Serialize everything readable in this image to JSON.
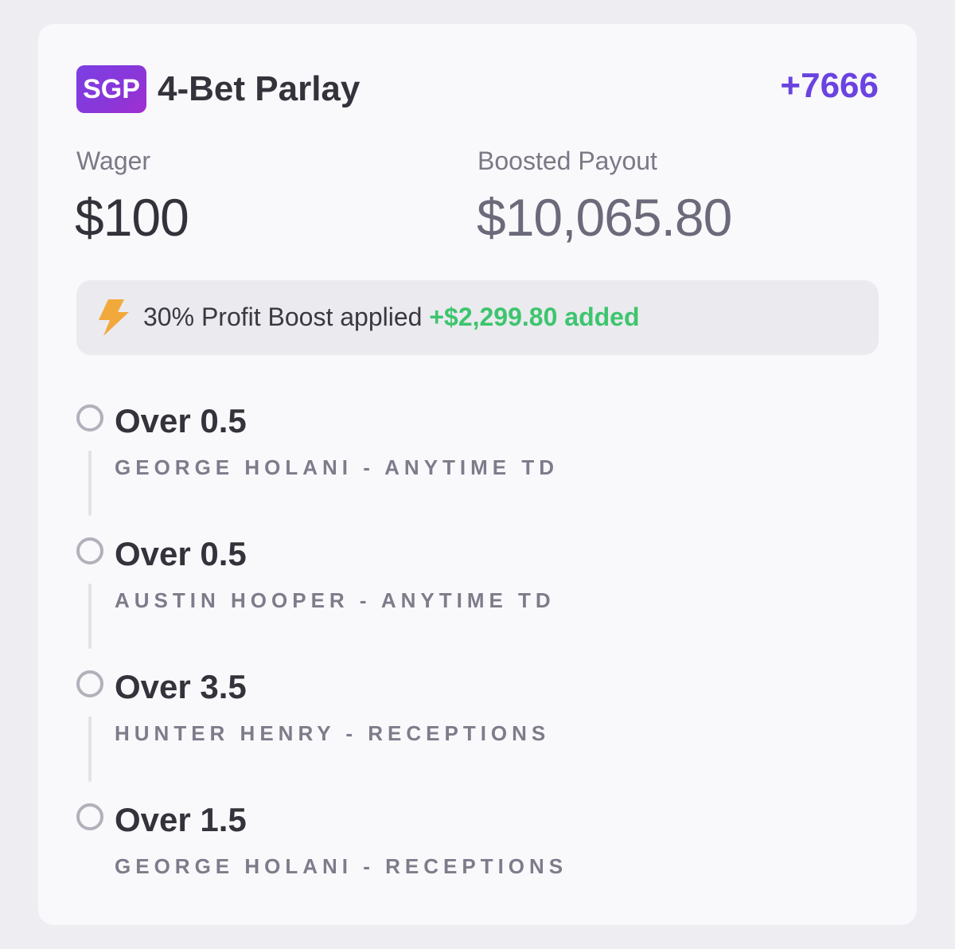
{
  "header": {
    "badge": "SGP",
    "title": "4-Bet Parlay",
    "odds": "+7666"
  },
  "wager": {
    "label": "Wager",
    "value": "$100"
  },
  "payout": {
    "label": "Boosted Payout",
    "value": "$10,065.80"
  },
  "boost": {
    "icon": "lightning-bolt-icon",
    "text": "30% Profit Boost applied",
    "added": "+$2,299.80 added"
  },
  "legs": [
    {
      "title": "Over 0.5",
      "subtitle": "GEORGE HOLANI - ANYTIME TD"
    },
    {
      "title": "Over 0.5",
      "subtitle": "AUSTIN HOOPER - ANYTIME TD"
    },
    {
      "title": "Over 3.5",
      "subtitle": "HUNTER HENRY - RECEPTIONS"
    },
    {
      "title": "Over 1.5",
      "subtitle": "GEORGE HOLANI - RECEPTIONS"
    }
  ],
  "colors": {
    "accent": "#6a43e0",
    "badge_gradient_start": "#7b3fe4",
    "badge_gradient_end": "#a12fd0",
    "boost_added": "#3dc56e",
    "bolt": "#f2a93b"
  }
}
